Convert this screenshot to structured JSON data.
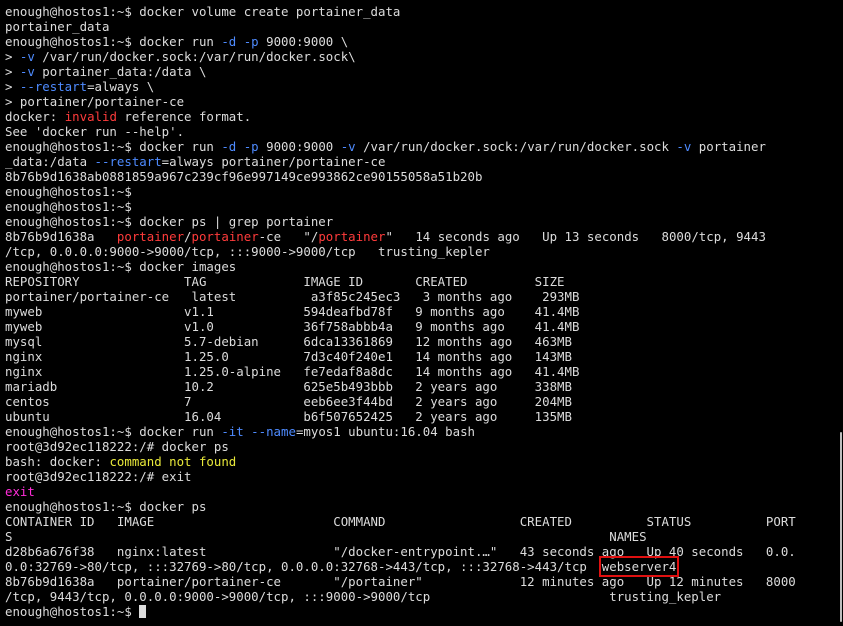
{
  "terminal": {
    "lines": [
      [
        {
          "t": "enough@hostos1:~$ docker volume create portainer_data"
        }
      ],
      [
        {
          "t": "portainer_data"
        }
      ],
      [
        {
          "t": "enough@hostos1:~$ docker run "
        },
        {
          "t": "-d -p",
          "c": "blue"
        },
        {
          "t": " 9000:9000 \\"
        }
      ],
      [
        {
          "t": "> "
        },
        {
          "t": "-v",
          "c": "blue"
        },
        {
          "t": " /var/run/docker.sock:/var/run/docker.sock\\"
        }
      ],
      [
        {
          "t": "> "
        },
        {
          "t": "-v",
          "c": "blue"
        },
        {
          "t": " portainer_data:/data \\"
        }
      ],
      [
        {
          "t": "> "
        },
        {
          "t": "--restart",
          "c": "blue"
        },
        {
          "t": "=always \\"
        }
      ],
      [
        {
          "t": "> portainer/portainer-ce"
        }
      ],
      [
        {
          "t": "docker: "
        },
        {
          "t": "invalid",
          "c": "red"
        },
        {
          "t": " reference format."
        }
      ],
      [
        {
          "t": "See 'docker run --help'."
        }
      ],
      [
        {
          "t": "enough@hostos1:~$ docker run "
        },
        {
          "t": "-d -p",
          "c": "blue"
        },
        {
          "t": " 9000:9000 "
        },
        {
          "t": "-v",
          "c": "blue"
        },
        {
          "t": " /var/run/docker.sock:/var/run/docker.sock "
        },
        {
          "t": "-v",
          "c": "blue"
        },
        {
          "t": " portainer"
        }
      ],
      [
        {
          "t": "_data:/data "
        },
        {
          "t": "--restart",
          "c": "blue"
        },
        {
          "t": "=always portainer/portainer-ce"
        }
      ],
      [
        {
          "t": "8b76b9d1638ab0881859a967c239cf96e997149ce993862ce90155058a51b20b"
        }
      ],
      [
        {
          "t": "enough@hostos1:~$"
        }
      ],
      [
        {
          "t": "enough@hostos1:~$"
        }
      ],
      [
        {
          "t": "enough@hostos1:~$ docker ps | grep portainer"
        }
      ],
      [
        {
          "t": "8b76b9d1638a   "
        },
        {
          "t": "portainer",
          "c": "red"
        },
        {
          "t": "/"
        },
        {
          "t": "portainer",
          "c": "red"
        },
        {
          "t": "-ce   \"/"
        },
        {
          "t": "portainer",
          "c": "red"
        },
        {
          "t": "\"   14 seconds ago   Up 13 seconds   8000/tcp, 9443"
        }
      ],
      [
        {
          "t": "/tcp, 0.0.0.0:9000->9000/tcp, :::9000->9000/tcp   trusting_kepler"
        }
      ],
      [
        {
          "t": "enough@hostos1:~$ docker images"
        }
      ],
      [
        {
          "t": "REPOSITORY              TAG             IMAGE ID       CREATED         SIZE"
        }
      ],
      [
        {
          "t": "portainer/portainer-ce   latest          a3f85c245ec3   3 months ago    293MB"
        }
      ],
      [
        {
          "t": "myweb                   v1.1            594deafbd78f   9 months ago    41.4MB"
        }
      ],
      [
        {
          "t": "myweb                   v1.0            36f758abbb4a   9 months ago    41.4MB"
        }
      ],
      [
        {
          "t": "mysql                   5.7-debian      6dca13361869   12 months ago   463MB"
        }
      ],
      [
        {
          "t": "nginx                   1.25.0          7d3c40f240e1   14 months ago   143MB"
        }
      ],
      [
        {
          "t": "nginx                   1.25.0-alpine   fe7edaf8a8dc   14 months ago   41.4MB"
        }
      ],
      [
        {
          "t": "mariadb                 10.2            625e5b493bbb   2 years ago     338MB"
        }
      ],
      [
        {
          "t": "centos                  7               eeb6ee3f44bd   2 years ago     204MB"
        }
      ],
      [
        {
          "t": "ubuntu                  16.04           b6f507652425   2 years ago     135MB"
        }
      ],
      [
        {
          "t": "enough@hostos1:~$ docker run "
        },
        {
          "t": "-it --name",
          "c": "blue"
        },
        {
          "t": "=myos1 ubuntu:16.04 bash"
        }
      ],
      [
        {
          "t": "root@3d92ec118222:/# docker ps"
        }
      ],
      [
        {
          "t": "bash: docker: "
        },
        {
          "t": "command not found",
          "c": "yellow"
        }
      ],
      [
        {
          "t": "root@3d92ec118222:/# exit"
        }
      ],
      [
        {
          "t": "exit",
          "c": "magenta"
        }
      ],
      [
        {
          "t": "enough@hostos1:~$ docker ps"
        }
      ],
      [
        {
          "t": "CONTAINER ID   IMAGE                        COMMAND                  CREATED          STATUS          PORT"
        }
      ],
      [
        {
          "t": "S                                                                                NAMES"
        }
      ],
      [
        {
          "t": "d28b6a676f38   nginx:latest                 \"/docker-entrypoint.…\"   43 seconds ago   Up 40 seconds   0.0."
        }
      ],
      [
        {
          "t": "0.0:32769->80/tcp, :::32769->80/tcp, 0.0.0.0:32768->443/tcp, :::32768->443/tcp  "
        },
        {
          "t": "webserver4",
          "box": true
        }
      ],
      [
        {
          "t": "8b76b9d1638a   portainer/portainer-ce       \"/portainer\"             12 minutes ago   Up 12 minutes   8000"
        }
      ],
      [
        {
          "t": "/tcp, 9443/tcp, 0.0.0.0:9000->9000/tcp, :::9000->9000/tcp                        trusting_kepler"
        }
      ],
      [
        {
          "t": "enough@hostos1:~$ "
        },
        {
          "cursor": true
        }
      ]
    ]
  },
  "colors": {
    "background": "#000000",
    "text": "#dcdcdc",
    "red": "#ff3b3b",
    "blue": "#4e8bff",
    "yellow": "#e8e83a",
    "magenta": "#ff2dd8",
    "highlight_box": "#e01010",
    "scrollbar": "#bdbdbd"
  }
}
